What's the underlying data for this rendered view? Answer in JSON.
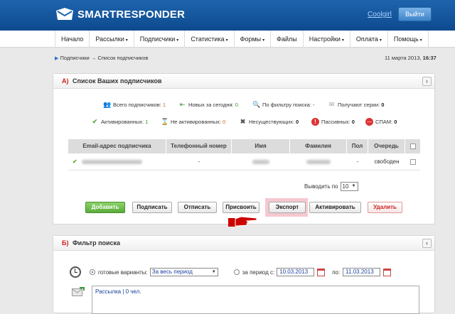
{
  "brand": {
    "name": "SMARTRESPONDER"
  },
  "user": {
    "name": "Coolgirl",
    "logout_label": "Выйти"
  },
  "nav": {
    "items": [
      {
        "label": "Начало",
        "dropdown": false
      },
      {
        "label": "Рассылки",
        "dropdown": true
      },
      {
        "label": "Подписчики",
        "dropdown": true
      },
      {
        "label": "Статистика",
        "dropdown": true
      },
      {
        "label": "Формы",
        "dropdown": true
      },
      {
        "label": "Файлы",
        "dropdown": false
      },
      {
        "label": "Настройки",
        "dropdown": true
      },
      {
        "label": "Оплата",
        "dropdown": true
      },
      {
        "label": "Помощь",
        "dropdown": true
      }
    ],
    "arrow": "▾"
  },
  "breadcrumb": {
    "parent": "Подписчики",
    "sep": "→",
    "current": "Список подписчиков"
  },
  "date": {
    "day": "11 марта 2013,",
    "time": "16:37"
  },
  "panel_a": {
    "letter": "А)",
    "title": "Список Ваших подписчиков",
    "stats_row1": [
      {
        "label": "Всего подписчиков:",
        "value": "1",
        "icon": "people-icon"
      },
      {
        "label": "Новых за сегодня:",
        "value": "0",
        "icon": "new-arrow-icon"
      },
      {
        "label": "По фильтру поиска:",
        "value": "-",
        "icon": "search-icon"
      },
      {
        "label": "Получают серии:",
        "value": "0",
        "icon": "envelope-icon"
      }
    ],
    "stats_row2": [
      {
        "label": "Активированных:",
        "value": "1",
        "icon": "check-icon"
      },
      {
        "label": "Не активированных:",
        "value": "0",
        "icon": "hourglass-icon"
      },
      {
        "label": "Несуществующих:",
        "value": "0",
        "icon": "cross-icon"
      },
      {
        "label": "Пассивных:",
        "value": "0",
        "icon": "alert-icon"
      },
      {
        "label": "СПАМ:",
        "value": "0",
        "icon": "stop-icon"
      }
    ],
    "table": {
      "columns": [
        "Email-адрес подписчика",
        "Телефонный номер",
        "Имя",
        "Фамилия",
        "Пол",
        "Очередь"
      ],
      "rows": [
        {
          "email": "",
          "phone": "-",
          "name": "",
          "surname": "",
          "gender": "-",
          "queue": "свободен"
        }
      ]
    },
    "per_page": {
      "label": "Выводить по",
      "value": "10"
    },
    "buttons": {
      "add": "Добавить",
      "subscribe": "Подписать",
      "unsubscribe": "Отписать",
      "assign": "Присвоить",
      "export": "Экспорт",
      "activate": "Активировать",
      "delete": "Удалить"
    }
  },
  "panel_b": {
    "letter": "Б)",
    "title": "Фильтр поиска",
    "preset_label": "готовые варианты:",
    "preset_value": "За весь период",
    "period_label": "за период с:",
    "date_from": "10.03.2013",
    "to_label": "по:",
    "date_to": "11.03.2013",
    "list_item": "Рассылка | 0 чел."
  },
  "colors": {
    "header": "#1e64ad",
    "accent_red": "#d02020",
    "highlight": "#f5c8d0"
  }
}
